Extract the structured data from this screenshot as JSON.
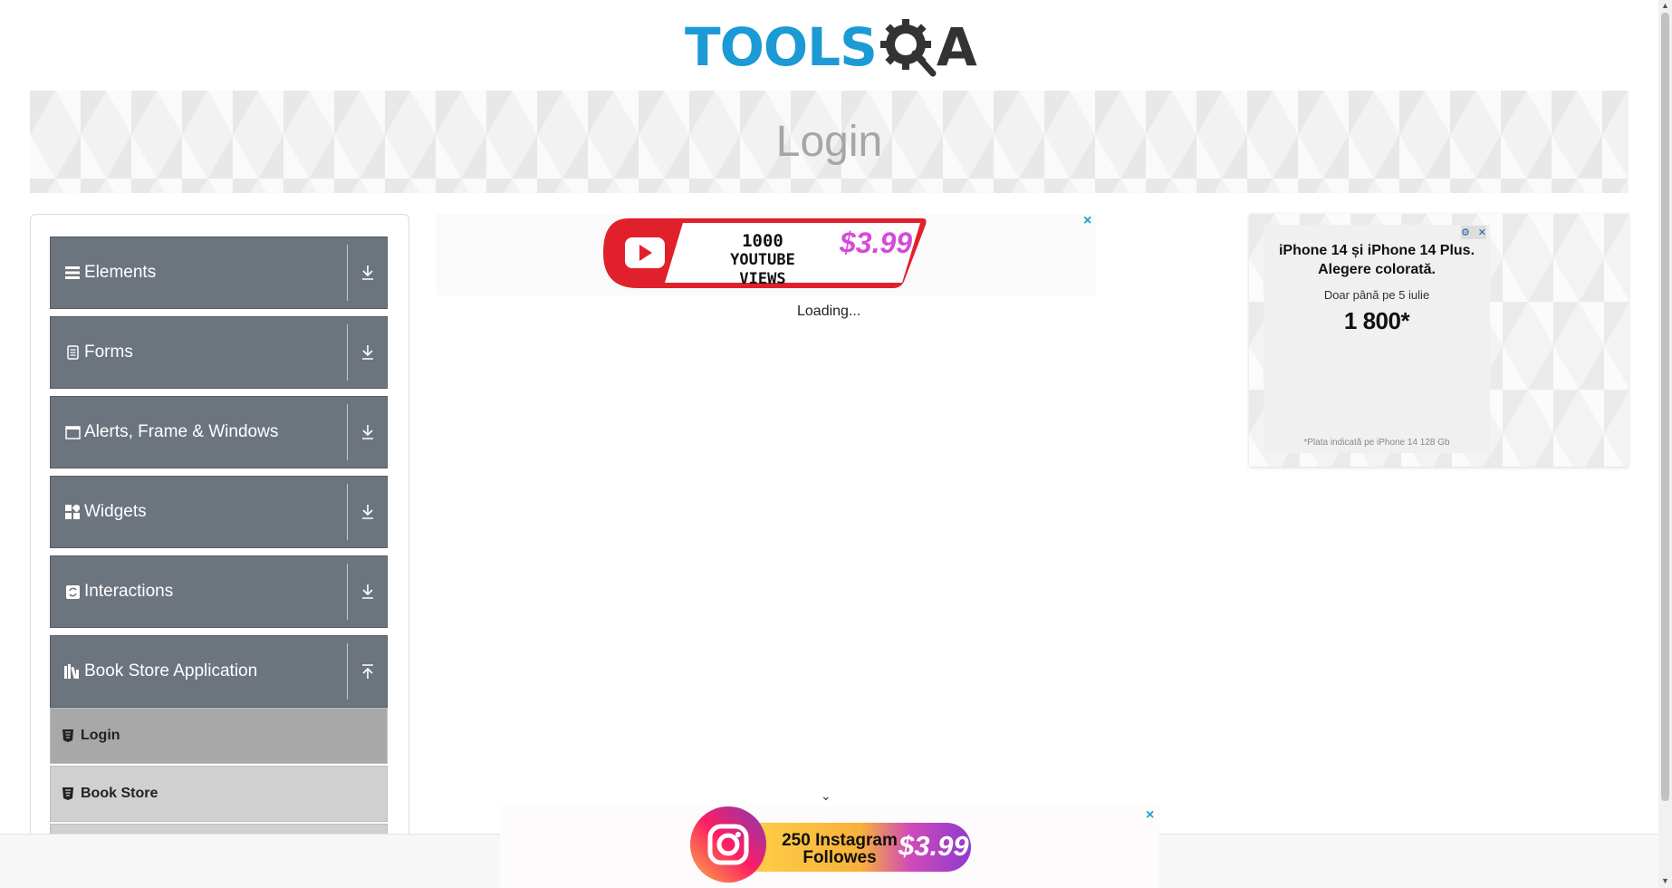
{
  "header": {
    "logo_tools": "TOOLS",
    "logo_qa": "A"
  },
  "banner": {
    "title": "Login"
  },
  "sidebar": {
    "groups": [
      {
        "label": "Elements",
        "icon": "hamburger-icon",
        "state": "collapsed"
      },
      {
        "label": "Forms",
        "icon": "document-icon",
        "state": "collapsed"
      },
      {
        "label": "Alerts, Frame & Windows",
        "icon": "window-icon",
        "state": "collapsed"
      },
      {
        "label": "Widgets",
        "icon": "widgets-icon",
        "state": "collapsed"
      },
      {
        "label": "Interactions",
        "icon": "interactions-icon",
        "state": "collapsed"
      },
      {
        "label": "Book Store Application",
        "icon": "books-icon",
        "state": "expanded"
      }
    ],
    "items": [
      {
        "label": "Login",
        "active": true
      },
      {
        "label": "Book Store",
        "active": false
      }
    ]
  },
  "ads": {
    "top": {
      "line1": "1000",
      "line2": "YOUTUBE VIEWS",
      "price": "$3.99",
      "close": "×"
    },
    "right": {
      "line1": "iPhone 14 și iPhone 14 Plus.",
      "line2": "Alegere colorată.",
      "line3": "Doar până pe 5 iulie",
      "price": "1 800*",
      "footnote": "*Plata indicată pe iPhone 14 128 Gb"
    },
    "bottom": {
      "line1": "250 Instagram",
      "line2": "Followes",
      "price": "$3.99",
      "close": "×"
    }
  },
  "main": {
    "status": "Loading..."
  },
  "colors": {
    "brand_blue": "#1c9ad6",
    "nav_group": "#6c747e",
    "nav_active": "#a8a8a8",
    "nav_item": "#d0d0d0"
  }
}
